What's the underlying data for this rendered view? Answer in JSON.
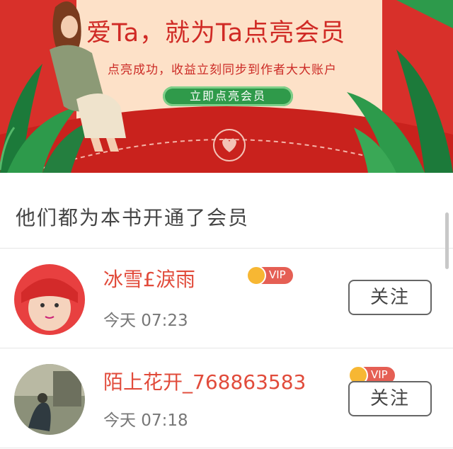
{
  "banner": {
    "title": "爱Ta，就为Ta点亮会员",
    "subtitle": "点亮成功，收益立刻同步到作者大大账户",
    "cta_label": "立即点亮会员"
  },
  "section": {
    "heading": "他们都为本书开通了会员"
  },
  "members": [
    {
      "name": "冰雪£淚雨",
      "badge": "VIP",
      "time": "今天  07:23",
      "follow_label": "关注",
      "avatar_icon": "baby-photo-avatar"
    },
    {
      "name": "陌上花开_768863583",
      "badge": "VIP",
      "time": "今天  07:18",
      "follow_label": "关注",
      "avatar_icon": "scenery-photo-avatar"
    }
  ],
  "colors": {
    "brand_red": "#d8302a",
    "name_red": "#e14b3b",
    "cta_green": "#2f9a4a",
    "vip_badge": "#e55f54"
  }
}
